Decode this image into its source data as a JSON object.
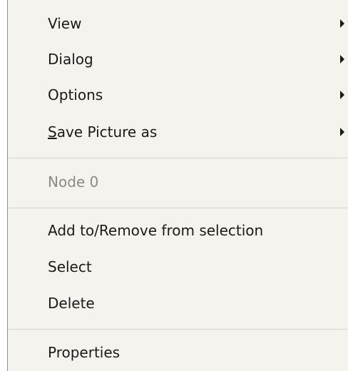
{
  "menu": {
    "items": [
      {
        "label": "View",
        "submenu": true
      },
      {
        "label": "Dialog",
        "submenu": true
      },
      {
        "label": "Options",
        "submenu": true
      },
      {
        "mnemonic": "S",
        "rest": "ave Picture as",
        "submenu": true
      },
      {
        "label": "Node 0",
        "disabled": true
      },
      {
        "label": "Add to/Remove from selection"
      },
      {
        "label": "Select"
      },
      {
        "label": "Delete"
      },
      {
        "label": "Properties"
      }
    ]
  }
}
